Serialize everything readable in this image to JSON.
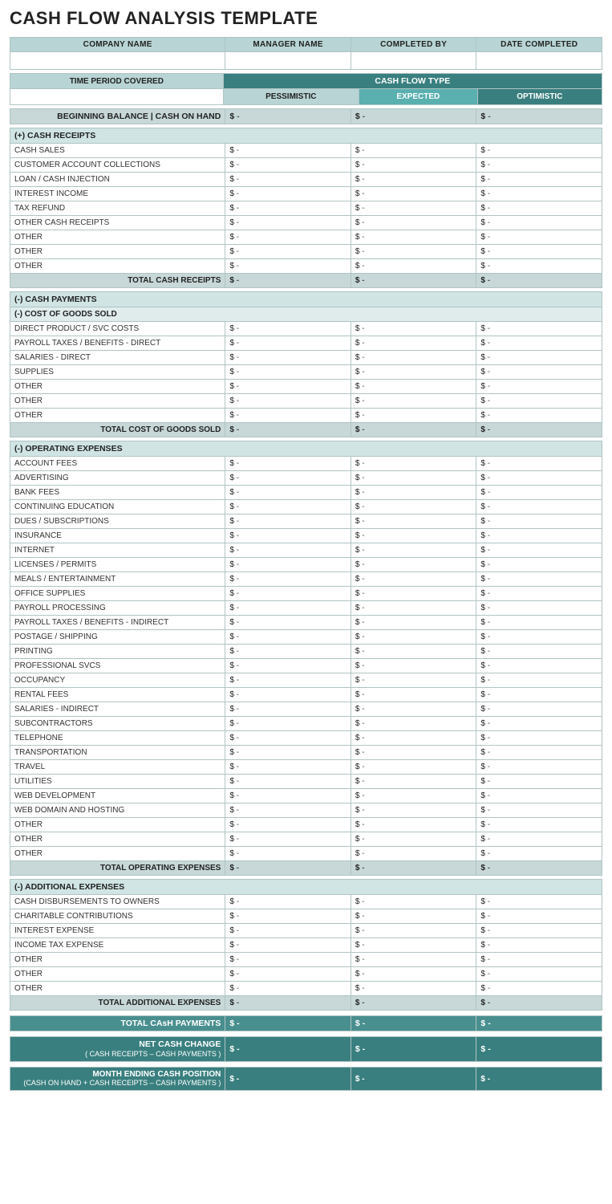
{
  "title": "CASH FLOW ANALYSIS TEMPLATE",
  "header": {
    "columns": [
      "COMPANY NAME",
      "MANAGER NAME",
      "COMPLETED BY",
      "DATE COMPLETED"
    ]
  },
  "time_period": {
    "label": "TIME PERIOD COVERED",
    "cash_flow_type": "CASH FLOW TYPE",
    "sub_cols": [
      "PESSIMISTIC",
      "EXPECTED",
      "OPTIMISTIC"
    ]
  },
  "beginning_balance": {
    "label": "BEGINNING BALANCE | CASH ON HAND",
    "values": [
      "-",
      "-",
      "-"
    ]
  },
  "cash_receipts": {
    "section_label": "(+)  CASH RECEIPTS",
    "items": [
      "CASH SALES",
      "CUSTOMER ACCOUNT COLLECTIONS",
      "LOAN / CASH INJECTION",
      "INTEREST INCOME",
      "TAX REFUND",
      "OTHER CASH RECEIPTS",
      "OTHER",
      "OTHER",
      "OTHER"
    ],
    "total_label": "TOTAL CASH RECEIPTS",
    "total_values": [
      "-",
      "-",
      "-"
    ]
  },
  "cash_payments": {
    "section_label": "(-) CASH PAYMENTS",
    "cost_of_goods": {
      "subsection_label": "(-) COST OF GOODS SOLD",
      "items": [
        "DIRECT PRODUCT / SVC COSTS",
        "PAYROLL TAXES / BENEFITS - DIRECT",
        "SALARIES - DIRECT",
        "SUPPLIES",
        "OTHER",
        "OTHER",
        "OTHER"
      ],
      "total_label": "TOTAL COST OF GOODS SOLD",
      "total_values": [
        "-",
        "-",
        "-"
      ]
    },
    "operating_expenses": {
      "subsection_label": "(-) OPERATING EXPENSES",
      "items": [
        "ACCOUNT FEES",
        "ADVERTISING",
        "BANK FEES",
        "CONTINUING EDUCATION",
        "DUES / SUBSCRIPTIONS",
        "INSURANCE",
        "INTERNET",
        "LICENSES / PERMITS",
        "MEALS / ENTERTAINMENT",
        "OFFICE SUPPLIES",
        "PAYROLL PROCESSING",
        "PAYROLL TAXES / BENEFITS - INDIRECT",
        "POSTAGE / SHIPPING",
        "PRINTING",
        "PROFESSIONAL SVCS",
        "OCCUPANCY",
        "RENTAL FEES",
        "SALARIES - INDIRECT",
        "SUBCONTRACTORS",
        "TELEPHONE",
        "TRANSPORTATION",
        "TRAVEL",
        "UTILITIES",
        "WEB DEVELOPMENT",
        "WEB DOMAIN AND HOSTING",
        "OTHER",
        "OTHER",
        "OTHER"
      ],
      "total_label": "TOTAL OPERATING EXPENSES",
      "total_values": [
        "-",
        "-",
        "-"
      ]
    },
    "additional_expenses": {
      "subsection_label": "(-) ADDITIONAL EXPENSES",
      "items": [
        "CASH DISBURSEMENTS TO OWNERS",
        "CHARITABLE CONTRIBUTIONS",
        "INTEREST EXPENSE",
        "INCOME TAX EXPENSE",
        "OTHER",
        "OTHER",
        "OTHER"
      ],
      "total_label": "TOTAL ADDITIONAL EXPENSES",
      "total_values": [
        "-",
        "-",
        "-"
      ]
    }
  },
  "total_cash_payments": {
    "label": "TOTAL CAsH PAYMENTS",
    "values": [
      "-",
      "-",
      "-"
    ]
  },
  "net_cash_change": {
    "label": "NET CASH CHANGE",
    "sublabel": "( CASH RECEIPTS – CASH PAYMENTS )",
    "values": [
      "-",
      "-",
      "-"
    ]
  },
  "month_ending": {
    "label": "MONTH ENDING CASH POSITION",
    "sublabel": "(CASH ON HAND + CASH RECEIPTS – CASH PAYMENTS )",
    "values": [
      "-",
      "-",
      "-"
    ]
  },
  "dollar_sign": "$",
  "dash": "-"
}
